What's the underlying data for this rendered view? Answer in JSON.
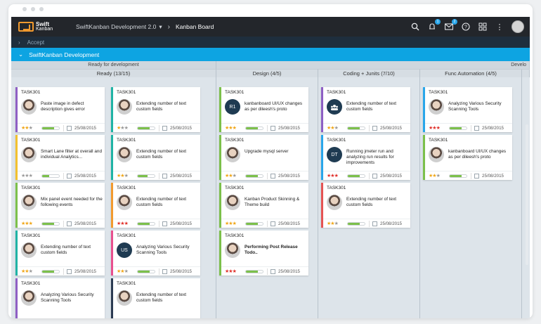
{
  "app": {
    "logo_line1": "Swift",
    "logo_line2": "Kanban",
    "project": "SwiftKanban Development 2.0",
    "breadcrumb": "Kanban Board"
  },
  "topbar": {
    "notif_count": "1",
    "mail_count": "2"
  },
  "accept_bar": {
    "label": "Accept"
  },
  "board_bar": {
    "label": "SwiftKanban Development"
  },
  "groups": [
    {
      "label": "Ready for development"
    },
    {
      "label": "Develo"
    }
  ],
  "columns": [
    {
      "label": "Ready (13/15)"
    },
    {
      "label": "Design (4/5)"
    },
    {
      "label": "Coding + Junits (7/10)"
    },
    {
      "label": "Func Automation (4/5)"
    }
  ],
  "colors": {
    "purple": "#8e5fc4",
    "orange": "#f29a2e",
    "green": "#7cc04b",
    "teal": "#1fb3a5",
    "pink": "#e84f8e",
    "navy": "#2b3b52",
    "blue": "#29a6ea",
    "red": "#e55353"
  },
  "cards": [
    {
      "id": "TASK301",
      "title": "Paste image in defect description gives error",
      "stars": "2",
      "star_color": "gold",
      "progress": 0.7,
      "date": "25/08/2015",
      "border": "#8e5fc4",
      "avatar": "photo"
    },
    {
      "id": "TASK301",
      "title": "Extending number of text custom fields",
      "stars": "1",
      "star_color": "gold",
      "progress": 0.7,
      "date": "25/08/2015",
      "border": "#1fb3a5",
      "avatar": "photo"
    },
    {
      "id": "TASK301",
      "title": "Smart Lane filter at overall and individual Analytics...",
      "stars": "0",
      "star_color": "gray",
      "progress": 0.4,
      "date": "25/08/2015",
      "border": "#f2c12e",
      "avatar": "photo"
    },
    {
      "id": "TASK301",
      "title": "Extending number of text custom fields",
      "stars": "2",
      "star_color": "gold",
      "progress": 0.6,
      "date": "25/08/2015",
      "border": "#1fb3a5",
      "avatar": "photo"
    },
    {
      "id": "TASK301",
      "title": "Mix panel event needed for the following events",
      "stars": "3",
      "star_color": "gold",
      "progress": 0.7,
      "date": "25/08/2015",
      "border": "#7cc04b",
      "avatar": "photo"
    },
    {
      "id": "TASK301",
      "title": "Extending number of text custom fields",
      "stars": "3",
      "star_color": "red",
      "progress": 0.7,
      "date": "25/08/2015",
      "border": "#f29a2e",
      "avatar": "photo"
    },
    {
      "id": "TASK301",
      "title": "Extending number of text custom fields",
      "stars": "2",
      "star_color": "gold",
      "progress": 0.7,
      "date": "25/08/2015",
      "border": "#1fb3a5",
      "avatar": "photo"
    },
    {
      "id": "TASK301",
      "title": "Analyzing Various Security Scanning Tools",
      "stars": "2",
      "star_color": "gold",
      "progress": 0.7,
      "date": "25/08/2015",
      "border": "#e84f8e",
      "avatar": "US"
    },
    {
      "id": "TASK301",
      "title": "Analyzing Various Security Scanning Tools",
      "stars": "",
      "star_color": "gold",
      "progress": 0,
      "date": "",
      "border": "#8e5fc4",
      "avatar": "photo"
    },
    {
      "id": "TASK301",
      "title": "Extending number of text custom fields",
      "stars": "",
      "star_color": "gold",
      "progress": 0,
      "date": "",
      "border": "#2b3b52",
      "avatar": "photo"
    },
    {
      "id": "TASK301",
      "title": "kanbanboard UI/UX changes as per dileesh's proto",
      "stars": "3",
      "star_color": "gold",
      "progress": 0.7,
      "date": "25/08/2015",
      "border": "#7cc04b",
      "avatar": "R1"
    },
    {
      "id": "TASK301",
      "title": "Upgrade mysql server",
      "stars": "2",
      "star_color": "gold",
      "progress": 0.7,
      "date": "25/08/2015",
      "border": "#7cc04b",
      "avatar": "photo"
    },
    {
      "id": "TASK301",
      "title": "Kanban Product Skinning & Theme build",
      "stars": "3",
      "star_color": "gold",
      "progress": 0.7,
      "date": "25/08/2015",
      "border": "#7cc04b",
      "avatar": "photo"
    },
    {
      "id": "TASK301",
      "title": "Performing Post Release Todo..",
      "stars": "3",
      "star_color": "red",
      "progress": 0.7,
      "date": "25/08/2015",
      "border": "#7cc04b",
      "avatar": "photo",
      "bold": true
    },
    {
      "id": "TASK301",
      "title": "Extending number of text custom fields",
      "stars": "2",
      "star_color": "gold",
      "progress": 0.7,
      "date": "25/08/2015",
      "border": "#8e5fc4",
      "avatar": "icon"
    },
    {
      "id": "TASK301",
      "title": "Running jmeter run and analyzing run results for improvements",
      "stars": "3",
      "star_color": "red",
      "progress": 0.7,
      "date": "25/08/2015",
      "border": "#29a6ea",
      "avatar": "DT"
    },
    {
      "id": "TASK301",
      "title": "Extending number of text custom fields",
      "stars": "2",
      "star_color": "gold",
      "progress": 0.7,
      "date": "25/08/2015",
      "border": "#e55353",
      "avatar": "photo"
    },
    {
      "id": "TASK301",
      "title": "Analyzing Various Security Scanning Tools",
      "stars": "3",
      "star_color": "red",
      "progress": 0.7,
      "date": "25/08/2015",
      "border": "#29a6ea",
      "avatar": "photo"
    },
    {
      "id": "TASK301",
      "title": "kanbanboard UI/UX changes as per dileesh's proto",
      "stars": "2",
      "star_color": "gold",
      "progress": 0.7,
      "date": "25/08/2015",
      "border": "#7cc04b",
      "avatar": "photo"
    }
  ]
}
